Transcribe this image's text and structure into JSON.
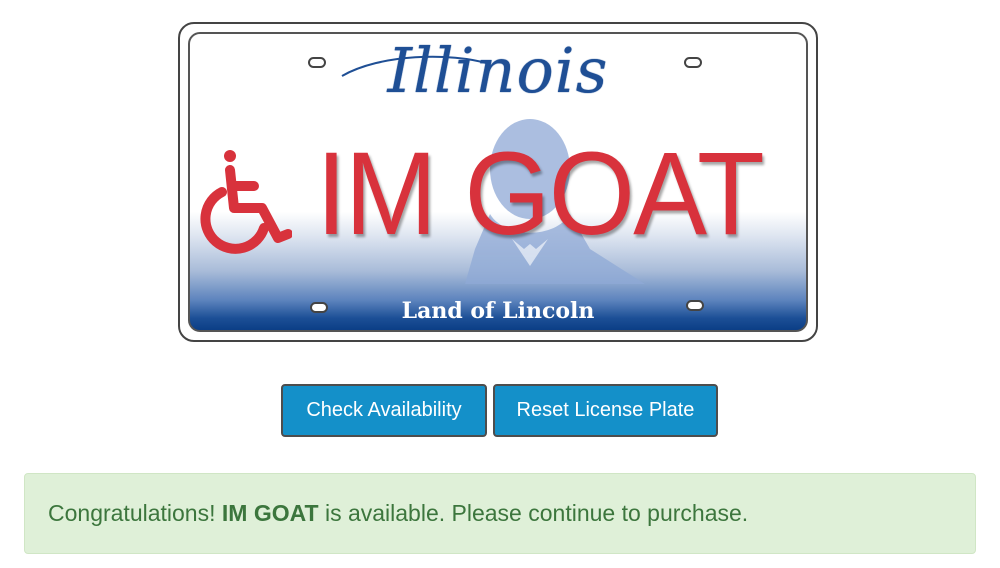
{
  "plate": {
    "state": "Illinois",
    "text": "IM GOAT",
    "slogan": "Land of Lincoln",
    "symbol_icon": "wheelchair-accessibility-icon",
    "text_color": "#d8323c",
    "state_color": "#1f4f95"
  },
  "buttons": {
    "check_label": "Check Availability",
    "reset_label": "Reset License Plate",
    "color": "#1490c9"
  },
  "alert": {
    "prefix": "Congratulations!",
    "plate_text": "IM GOAT",
    "suffix": "is available. Please continue to purchase.",
    "background": "#dff0d8",
    "text_color": "#3c763d"
  }
}
